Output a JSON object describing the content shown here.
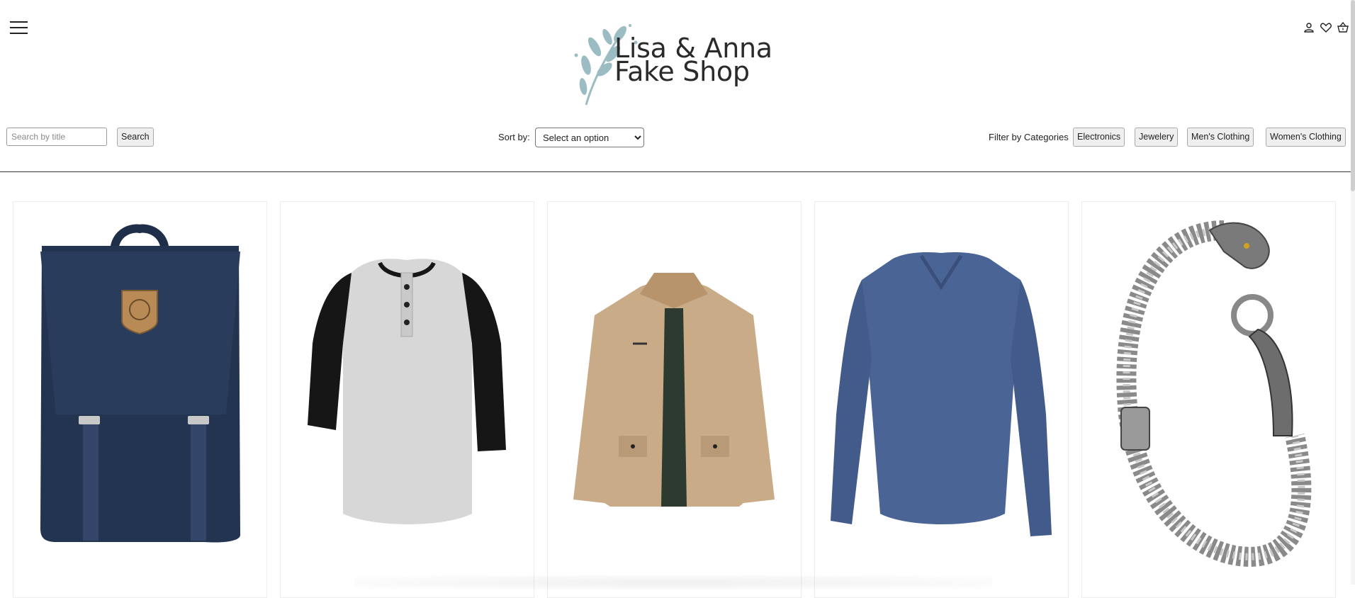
{
  "header": {
    "logo_line1": "Lisa & Anna",
    "logo_line2": "Fake Shop",
    "icons": [
      "user-icon",
      "heart-icon",
      "basket-icon"
    ]
  },
  "search": {
    "placeholder": "Search by title",
    "button_label": "Search"
  },
  "sort": {
    "label": "Sort by:",
    "selected": "Select an option"
  },
  "filter": {
    "label": "Filter by Categories",
    "categories": [
      "Electronics",
      "Jewelery",
      "Men's Clothing",
      "Women's Clothing"
    ]
  },
  "products": [
    {
      "image": "navy-backpack"
    },
    {
      "image": "raglan-henley-shirt"
    },
    {
      "image": "khaki-jacket"
    },
    {
      "image": "blue-long-sleeve-tee"
    },
    {
      "image": "silver-dragon-bracelet"
    }
  ],
  "colors": {
    "accent_leaf": "#9bbcc3",
    "text": "#222222",
    "navy": "#233451",
    "khaki": "#c9ab88",
    "blue_tee": "#4a6496"
  }
}
